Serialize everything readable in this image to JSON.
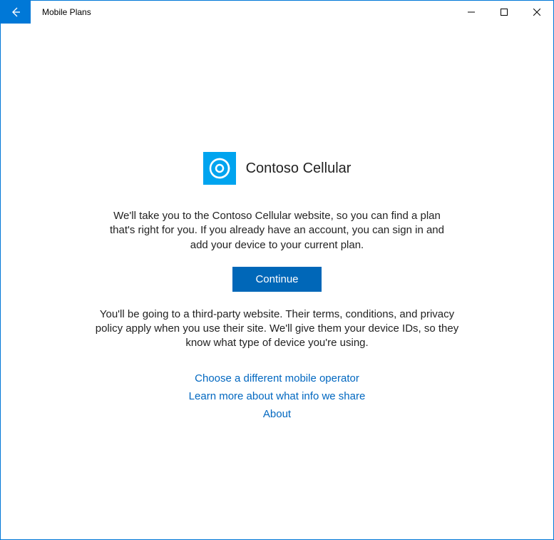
{
  "titlebar": {
    "app_title": "Mobile Plans"
  },
  "brand": {
    "name": "Contoso Cellular"
  },
  "description": "We'll take you to the Contoso Cellular website, so you can find a plan that's right for you. If you already have an account, you can sign in and add your device to your current plan.",
  "continue_label": "Continue",
  "disclaimer": "You'll be going to a third-party website. Their terms, conditions, and privacy policy apply when you use their site. We'll give them your device IDs, so they know what type of device you're using.",
  "links": {
    "choose_operator": "Choose a different mobile operator",
    "learn_more": "Learn more about what info we share",
    "about": "About"
  }
}
